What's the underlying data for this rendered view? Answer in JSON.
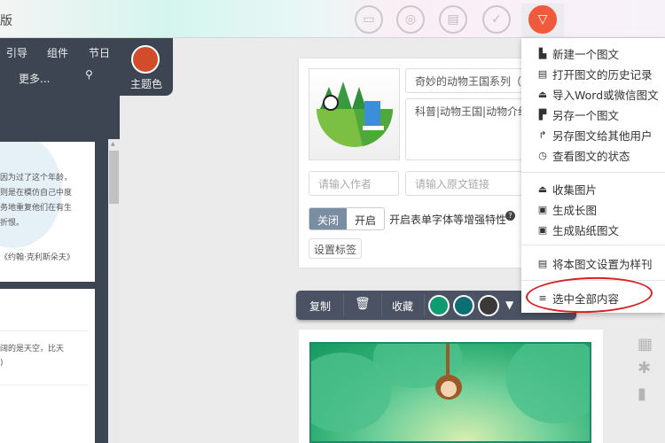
{
  "header": {
    "title_partial": "版",
    "icons": [
      "folder-icon",
      "collection-icon",
      "print-icon",
      "check-icon",
      "menu-toggle-icon"
    ]
  },
  "sidebar": {
    "nav": [
      "引导",
      "组件",
      "节日"
    ],
    "more": "更多...",
    "theme_label": "主题色",
    "theme_color": "#d24b2a",
    "card1_lines": [
      "因为过了这个年龄，",
      "则是在模仿自己中度",
      "务地重复他们在有生",
      "折恨。",
      "《约翰·克利斯朵夫》"
    ],
    "card2_lines": [
      "阔的是天空，比天",
      ")"
    ]
  },
  "editor": {
    "title_value": "奇妙的动物王国系列（节",
    "summary_value": "科普|动物王国|动物介绍",
    "author_placeholder": "请输入作者",
    "link_placeholder": "请输入原文链接",
    "toggle_off": "关闭",
    "toggle_on": "开启",
    "toggle_desc": "开启表单字体等增强特性",
    "tag_button": "设置标签"
  },
  "menu": {
    "group1": [
      {
        "icon": "file-icon",
        "label": "新建一个图文"
      },
      {
        "icon": "history-icon",
        "label": "打开图文的历史记录"
      },
      {
        "icon": "import-icon",
        "label": "导入Word或微信图文"
      },
      {
        "icon": "save-as-icon",
        "label": "另存一个图文"
      },
      {
        "icon": "share-icon",
        "label": "另存图文给其他用户"
      },
      {
        "icon": "status-icon",
        "label": "查看图文的状态"
      }
    ],
    "group2": [
      {
        "icon": "collect-image-icon",
        "label": "收集图片"
      },
      {
        "icon": "image-icon",
        "label": "生成长图"
      },
      {
        "icon": "image-icon",
        "label": "生成贴纸图文"
      }
    ],
    "group3": [
      {
        "icon": "template-icon",
        "label": "将本图文设置为样刊"
      }
    ],
    "group4": [
      {
        "icon": "select-all-icon",
        "label": "选中全部内容"
      }
    ]
  },
  "toolbar": {
    "copy": "复制",
    "collect": "收藏",
    "colors": [
      "#0f9b72",
      "#0b6f73",
      "#3a3a3a"
    ]
  }
}
